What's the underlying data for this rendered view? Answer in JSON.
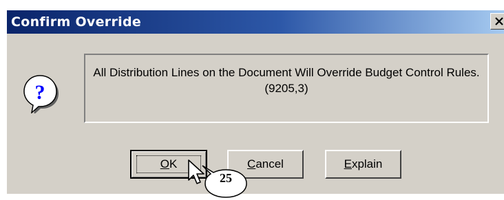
{
  "window": {
    "title": "Confirm Override"
  },
  "message": {
    "text": "All Distribution Lines on the Document Will Override Budget Control Rules. (9205,3)"
  },
  "buttons": {
    "ok": {
      "mnemonic": "O",
      "rest": "K"
    },
    "cancel": {
      "mnemonic": "C",
      "rest": "ancel"
    },
    "explain": {
      "mnemonic": "E",
      "rest": "xplain"
    }
  },
  "annotation": {
    "step": "25"
  },
  "icons": {
    "dialog": "question-icon",
    "close": "close-icon",
    "pointer": "mouse-pointer-icon"
  },
  "colors": {
    "title_start": "#0a246a",
    "title_end": "#a6caf0",
    "face": "#d4d0c8"
  }
}
